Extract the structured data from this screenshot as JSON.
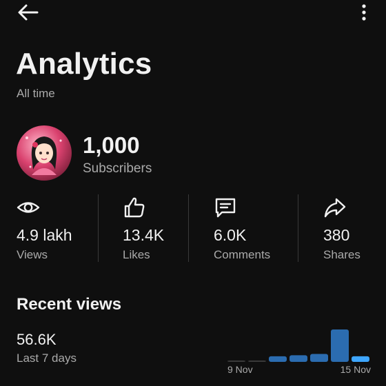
{
  "header": {
    "back_icon": "arrow-left-icon",
    "more_icon": "more-vertical-icon"
  },
  "page": {
    "title": "Analytics",
    "subtitle": "All time"
  },
  "channel": {
    "subscriber_count": "1,000",
    "subscriber_label": "Subscribers"
  },
  "stats": [
    {
      "icon": "eye-icon",
      "value": "4.9 lakh",
      "label": "Views"
    },
    {
      "icon": "thumbs-up-icon",
      "value": "13.4K",
      "label": "Likes"
    },
    {
      "icon": "comment-icon",
      "value": "6.0K",
      "label": "Comments"
    },
    {
      "icon": "share-icon",
      "value": "380",
      "label": "Shares"
    }
  ],
  "recent": {
    "title": "Recent views",
    "value": "56.6K",
    "label": "Last 7 days"
  },
  "chart_data": {
    "type": "bar",
    "x_tick_labels": [
      "9 Nov",
      "15 Nov"
    ],
    "relative_values": [
      0.03,
      0.03,
      0.17,
      0.2,
      0.24,
      0.98,
      0.17
    ],
    "colors": {
      "muted": "#3a3a3a",
      "bar": "#2b6cb0",
      "highlight": "#3ea6ff"
    }
  },
  "colors": {
    "background": "#0f0f0f",
    "text": "#f1f1f1",
    "secondary_text": "#aaaaaa"
  }
}
